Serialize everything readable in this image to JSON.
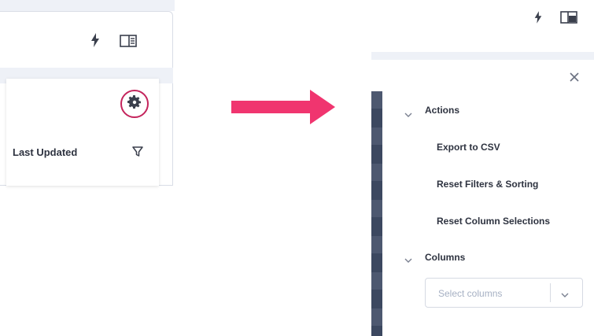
{
  "left": {
    "column_header": "Last Updated",
    "icons": {
      "bolt": "bolt-icon",
      "panel": "panel-toggle-icon",
      "gear": "gear-icon",
      "filter": "filter-icon"
    },
    "highlight_color": "#c4245c"
  },
  "arrow": {
    "color": "#f0356f"
  },
  "right": {
    "icons": {
      "bolt": "bolt-icon",
      "panel": "panel-toggle-icon",
      "close": "close-icon"
    },
    "actions": {
      "heading": "Actions",
      "items": [
        "Export to CSV",
        "Reset Filters & Sorting",
        "Reset Column Selections"
      ]
    },
    "columns": {
      "heading": "Columns",
      "select_placeholder": "Select columns"
    }
  }
}
